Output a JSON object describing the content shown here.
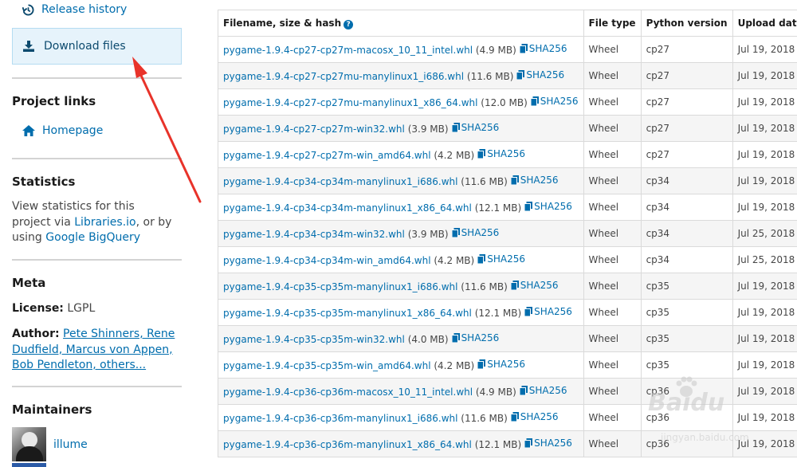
{
  "sidebar": {
    "release_history": "Release history",
    "download_files": "Download files",
    "project_links_heading": "Project links",
    "homepage": "Homepage",
    "statistics_heading": "Statistics",
    "stats_text_1": "View statistics for this project via ",
    "stats_link_libraries": "Libraries.io",
    "stats_text_2": ", or by using ",
    "stats_link_bigquery": "Google BigQuery",
    "meta_heading": "Meta",
    "license_label": "License:",
    "license_value": " LGPL",
    "author_label": "Author:",
    "author_value": "Pete Shinners, Rene Dudfield, Marcus von Appen, Bob Pendleton, others...",
    "maintainers_heading": "Maintainers",
    "maintainer_name": "illume"
  },
  "table": {
    "headers": {
      "filename": "Filename, size & hash",
      "help": "?",
      "file_type": "File type",
      "python_version": "Python version",
      "upload_date": "Upload date"
    },
    "sha_label": "SHA256",
    "rows": [
      {
        "file": "pygame-1.9.4-cp27-cp27m-macosx_10_11_intel.whl",
        "size": "(4.9 MB)",
        "type": "Wheel",
        "py": "cp27",
        "date": "Jul 19, 2018"
      },
      {
        "file": "pygame-1.9.4-cp27-cp27mu-manylinux1_i686.whl",
        "size": "(11.6 MB)",
        "type": "Wheel",
        "py": "cp27",
        "date": "Jul 19, 2018"
      },
      {
        "file": "pygame-1.9.4-cp27-cp27mu-manylinux1_x86_64.whl",
        "size": "(12.0 MB)",
        "type": "Wheel",
        "py": "cp27",
        "date": "Jul 19, 2018"
      },
      {
        "file": "pygame-1.9.4-cp27-cp27m-win32.whl",
        "size": "(3.9 MB)",
        "type": "Wheel",
        "py": "cp27",
        "date": "Jul 19, 2018"
      },
      {
        "file": "pygame-1.9.4-cp27-cp27m-win_amd64.whl",
        "size": "(4.2 MB)",
        "type": "Wheel",
        "py": "cp27",
        "date": "Jul 19, 2018"
      },
      {
        "file": "pygame-1.9.4-cp34-cp34m-manylinux1_i686.whl",
        "size": "(11.6 MB)",
        "type": "Wheel",
        "py": "cp34",
        "date": "Jul 19, 2018"
      },
      {
        "file": "pygame-1.9.4-cp34-cp34m-manylinux1_x86_64.whl",
        "size": "(12.1 MB)",
        "type": "Wheel",
        "py": "cp34",
        "date": "Jul 19, 2018"
      },
      {
        "file": "pygame-1.9.4-cp34-cp34m-win32.whl",
        "size": "(3.9 MB)",
        "type": "Wheel",
        "py": "cp34",
        "date": "Jul 25, 2018"
      },
      {
        "file": "pygame-1.9.4-cp34-cp34m-win_amd64.whl",
        "size": "(4.2 MB)",
        "type": "Wheel",
        "py": "cp34",
        "date": "Jul 25, 2018"
      },
      {
        "file": "pygame-1.9.4-cp35-cp35m-manylinux1_i686.whl",
        "size": "(11.6 MB)",
        "type": "Wheel",
        "py": "cp35",
        "date": "Jul 19, 2018"
      },
      {
        "file": "pygame-1.9.4-cp35-cp35m-manylinux1_x86_64.whl",
        "size": "(12.1 MB)",
        "type": "Wheel",
        "py": "cp35",
        "date": "Jul 19, 2018"
      },
      {
        "file": "pygame-1.9.4-cp35-cp35m-win32.whl",
        "size": "(4.0 MB)",
        "type": "Wheel",
        "py": "cp35",
        "date": "Jul 19, 2018"
      },
      {
        "file": "pygame-1.9.4-cp35-cp35m-win_amd64.whl",
        "size": "(4.2 MB)",
        "type": "Wheel",
        "py": "cp35",
        "date": "Jul 19, 2018"
      },
      {
        "file": "pygame-1.9.4-cp36-cp36m-macosx_10_11_intel.whl",
        "size": "(4.9 MB)",
        "type": "Wheel",
        "py": "cp36",
        "date": "Jul 19, 2018"
      },
      {
        "file": "pygame-1.9.4-cp36-cp36m-manylinux1_i686.whl",
        "size": "(11.6 MB)",
        "type": "Wheel",
        "py": "cp36",
        "date": "Jul 19, 2018"
      },
      {
        "file": "pygame-1.9.4-cp36-cp36m-manylinux1_x86_64.whl",
        "size": "(12.1 MB)",
        "type": "Wheel",
        "py": "cp36",
        "date": "Jul 19, 2018"
      }
    ]
  },
  "watermark": {
    "text": "Baidu",
    "sub": "jingyan.baidu.com"
  },
  "colors": {
    "link": "#006dad",
    "download_box_bg": "#e6f3fb",
    "arrow": "#e8332a"
  }
}
